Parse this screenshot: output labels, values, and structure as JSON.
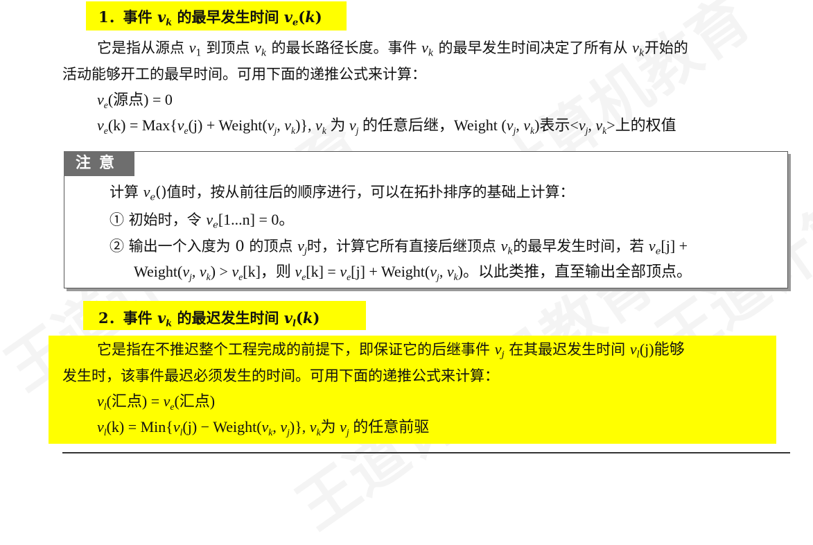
{
  "watermark": "王道计算机教育",
  "section1": {
    "heading_prefix": "1．事件",
    "heading_mid": "的最早发生时间",
    "para_l1_a": "它是指从源点",
    "para_l1_b": "到顶点",
    "para_l1_c": "的最长路径长度。事件",
    "para_l1_d": "的最早发生时间决定了所有从",
    "para_l1_e": "开始的",
    "para_l2": "活动能够开工的最早时间。可用下面的递推公式来计算：",
    "f1_rest": "(源点) = 0",
    "f2_a": "(k) = Max{",
    "f2_b": "(j) + Weight(",
    "f2_c": ")}, ",
    "f2_d": "为",
    "f2_e": "的任意后继，Weight (",
    "f2_f": ")表示<",
    "f2_g": ">上的权值"
  },
  "note": {
    "tag": "注意",
    "l1_a": "计算",
    "l1_b": "()值时，按从前往后的顺序进行，可以在拓扑排序的基础上计算：",
    "l2_a": "① 初始时，令",
    "l2_b": "[1...n] = 0。",
    "l3_a": "② 输出一个入度为 0 的顶点",
    "l3_b": "时，计算它所有直接后继顶点",
    "l3_c": "的最早发生时间，若",
    "l3_d": "[j] +",
    "l4_a": "Weight(",
    "l4_b": ") >",
    "l4_c": "[k]，则",
    "l4_d": "[k] =",
    "l4_e": "[j] + Weight(",
    "l4_f": ")。以此类推，直至输出全部顶点。"
  },
  "section2": {
    "heading_prefix": "2．事件",
    "heading_mid": "的最迟发生时间",
    "para_l1_a": "它是指在不推迟整个工程完成的前提下，即保证它的后继事件",
    "para_l1_b": "在其最迟发生时间",
    "para_l1_c": "(j)能够",
    "para_l2": "发生时，该事件最迟必须发生的时间。可用下面的递推公式来计算：",
    "f1_a": "(汇点) =",
    "f1_b": "(汇点)",
    "f2_a": "(k) = Min{",
    "f2_b": "(j) − Weight(",
    "f2_c": ")}, ",
    "f2_d": "为",
    "f2_e": "的任意前驱"
  },
  "colors": {
    "highlight": "#ffff00",
    "note_tag_bg": "#6e6e6e",
    "note_border": "#555555"
  }
}
